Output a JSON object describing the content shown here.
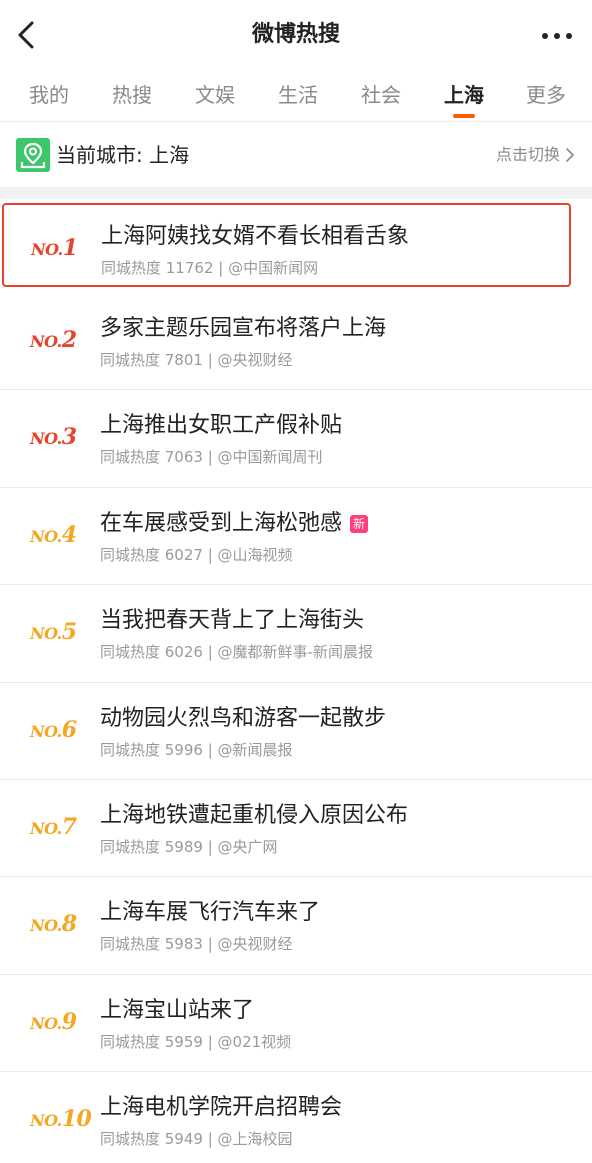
{
  "header": {
    "title": "微博热搜"
  },
  "tabs": [
    {
      "label": "我的",
      "active": false
    },
    {
      "label": "热搜",
      "active": false
    },
    {
      "label": "文娱",
      "active": false
    },
    {
      "label": "生活",
      "active": false
    },
    {
      "label": "社会",
      "active": false
    },
    {
      "label": "上海",
      "active": true
    },
    {
      "label": "更多",
      "active": false
    }
  ],
  "city": {
    "label": "当前城市: 上海",
    "switch_label": "点击切换"
  },
  "colors": {
    "accent": "#ff5a00",
    "rank_top": "#e8432a",
    "rank_other": "#f5a623",
    "highlight_border": "#e8432a",
    "new_badge": "#ff3e7a",
    "city_icon": "#3cc76a"
  },
  "items": [
    {
      "no": "NO.",
      "num": "1",
      "title": "上海阿姨找女婿不看长相看舌象",
      "meta": "同城热度 11762 | @中国新闻网",
      "badge": ""
    },
    {
      "no": "NO.",
      "num": "2",
      "title": "多家主题乐园宣布将落户上海",
      "meta": "同城热度 7801 | @央视财经",
      "badge": ""
    },
    {
      "no": "NO.",
      "num": "3",
      "title": "上海推出女职工产假补贴",
      "meta": "同城热度 7063 | @中国新闻周刊",
      "badge": ""
    },
    {
      "no": "NO.",
      "num": "4",
      "title": "在车展感受到上海松弛感",
      "meta": "同城热度 6027 | @山海视频",
      "badge": "新"
    },
    {
      "no": "NO.",
      "num": "5",
      "title": "当我把春天背上了上海街头",
      "meta": "同城热度 6026 | @魔都新鲜事-新闻晨报",
      "badge": ""
    },
    {
      "no": "NO.",
      "num": "6",
      "title": "动物园火烈鸟和游客一起散步",
      "meta": "同城热度 5996 | @新闻晨报",
      "badge": ""
    },
    {
      "no": "NO.",
      "num": "7",
      "title": "上海地铁遭起重机侵入原因公布",
      "meta": "同城热度 5989 | @央广网",
      "badge": ""
    },
    {
      "no": "NO.",
      "num": "8",
      "title": "上海车展飞行汽车来了",
      "meta": "同城热度 5983 | @央视财经",
      "badge": ""
    },
    {
      "no": "NO.",
      "num": "9",
      "title": "上海宝山站来了",
      "meta": "同城热度 5959 | @021视频",
      "badge": ""
    },
    {
      "no": "NO.",
      "num": "10",
      "title": "上海电机学院开启招聘会",
      "meta": "同城热度 5949 | @上海校园",
      "badge": ""
    }
  ]
}
